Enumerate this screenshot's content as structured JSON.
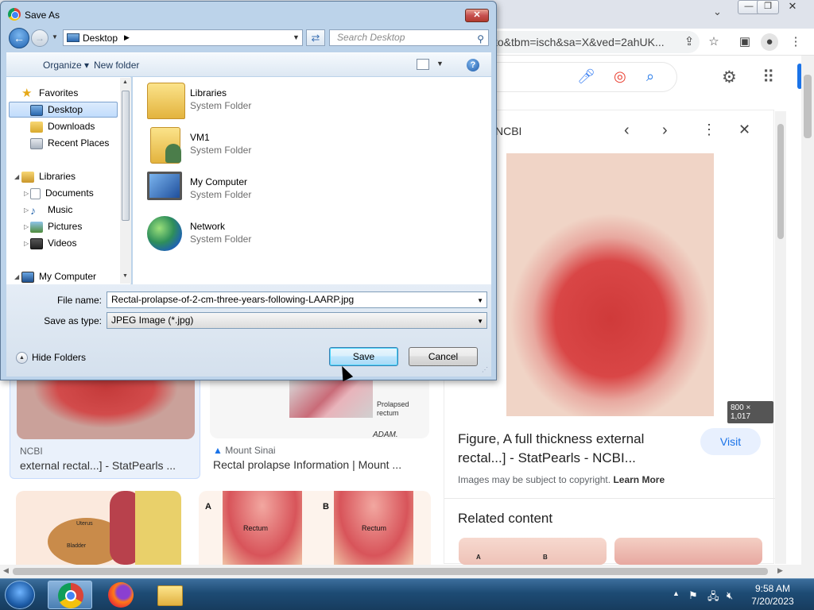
{
  "browser": {
    "omnibox_text": "to&tbm=isch&sa=X&ved=2ahUK...",
    "gsearch_icons": [
      "mic-icon",
      "lens-icon",
      "search-icon"
    ]
  },
  "panel": {
    "source": "NCBI",
    "size_badge": "800 × 1,017",
    "title": "Figure, A full thickness external rectal...] - StatPearls - NCBI...",
    "visit_label": "Visit",
    "copyright": "Images may be subject to copyright.",
    "learn_more": "Learn More",
    "related": "Related content"
  },
  "results": [
    {
      "source": "NCBI",
      "title": "external rectal...] - StatPearls ..."
    },
    {
      "source": "Mount Sinai",
      "title": "Rectal prolapse Information | Mount ...",
      "caption1": "Prolapsed",
      "caption2": "rectum",
      "brand": "ADAM."
    },
    {
      "label_a": "A",
      "label_b": "B",
      "rectum1": "Rectum",
      "rectum2": "Rectum",
      "uterus": "Uterus",
      "bladder": "Bladder"
    }
  ],
  "related_labels": {
    "a": "A",
    "b": "B"
  },
  "dialog": {
    "title": "Save As",
    "close": "✕",
    "location": "Desktop",
    "search_placeholder": "Search Desktop",
    "organize": "Organize ▾",
    "new_folder": "New folder",
    "help": "?",
    "nav": {
      "favorites": "Favorites",
      "desktop": "Desktop",
      "downloads": "Downloads",
      "recent": "Recent Places",
      "libraries": "Libraries",
      "documents": "Documents",
      "music": "Music",
      "pictures": "Pictures",
      "videos": "Videos",
      "mycomputer": "My Computer"
    },
    "files": [
      {
        "name": "Libraries",
        "desc": "System Folder"
      },
      {
        "name": "VM1",
        "desc": "System Folder"
      },
      {
        "name": "My Computer",
        "desc": "System Folder"
      },
      {
        "name": "Network",
        "desc": "System Folder"
      }
    ],
    "file_name_label": "File name:",
    "file_name_value": "Rectal-prolapse-of-2-cm-three-years-following-LAARP.jpg",
    "save_type_label": "Save as type:",
    "save_type_value": "JPEG Image (*.jpg)",
    "hide_folders": "Hide Folders",
    "save": "Save",
    "cancel": "Cancel"
  },
  "taskbar": {
    "time": "9:58 AM",
    "date": "7/20/2023"
  }
}
